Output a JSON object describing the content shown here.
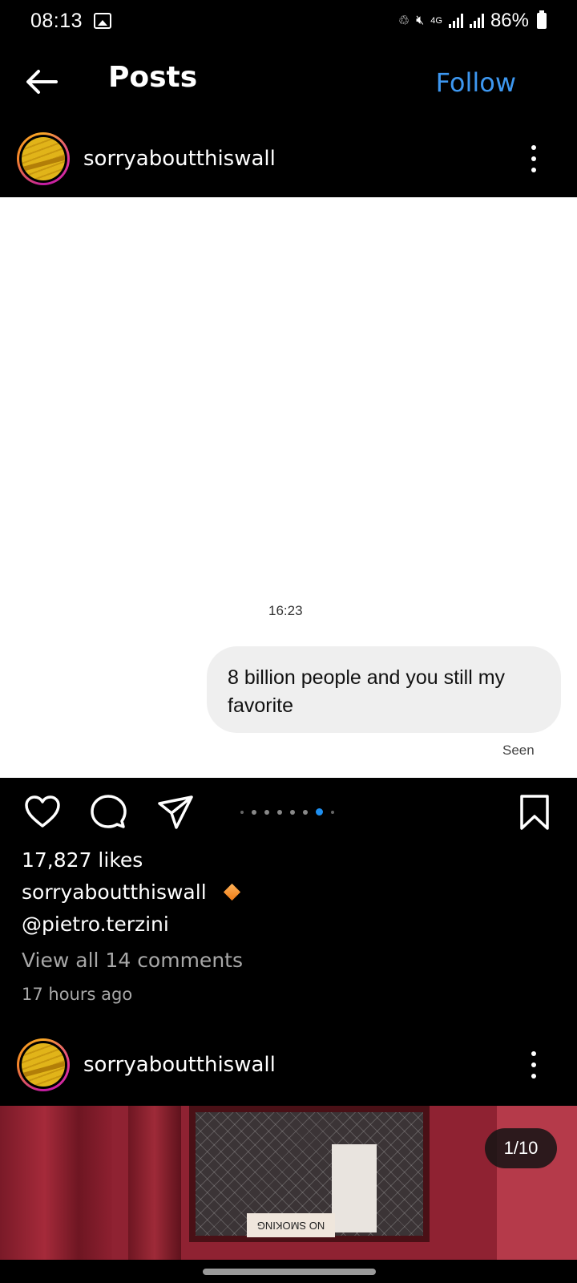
{
  "status_bar": {
    "time": "08:13",
    "network": "4G",
    "battery": "86%"
  },
  "header": {
    "title": "Posts",
    "follow_label": "Follow"
  },
  "post1": {
    "username": "sorryaboutthiswall",
    "message_time": "16:23",
    "message_text": "8 billion people and you still my favorite",
    "seen_label": "Seen",
    "likes": "17,827 likes",
    "caption_user": "sorryaboutthiswall",
    "mention": "@pietro.terzini",
    "comments_link": "View all 14 comments",
    "time_ago": "17 hours ago",
    "carousel_dots": 8,
    "carousel_active_index": 6
  },
  "post2": {
    "username": "sorryaboutthiswall",
    "counter": "1/10",
    "sign_text": "NO SMOKING"
  },
  "colors": {
    "accent_blue": "#3d97f0",
    "background": "#000000",
    "bubble": "#efefef"
  }
}
